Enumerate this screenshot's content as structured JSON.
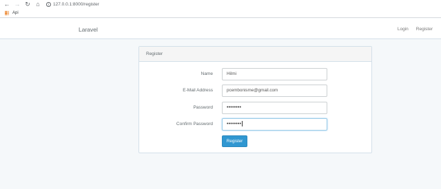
{
  "browser": {
    "url": "127.0.0.1:8000/register",
    "bookmarks": [
      {
        "label": "Api"
      }
    ]
  },
  "navbar": {
    "brand": "Laravel",
    "links": [
      {
        "label": "Login"
      },
      {
        "label": "Register"
      }
    ]
  },
  "card": {
    "title": "Register",
    "fields": {
      "name": {
        "label": "Name",
        "value": "Hilmi"
      },
      "email": {
        "label": "E-Mail Address",
        "value": "pcembonisme@gmail.com"
      },
      "password": {
        "label": "Password",
        "value": "••••••••"
      },
      "confirm": {
        "label": "Confirm Password",
        "value": "••••••••"
      }
    },
    "submit_label": "Register"
  }
}
